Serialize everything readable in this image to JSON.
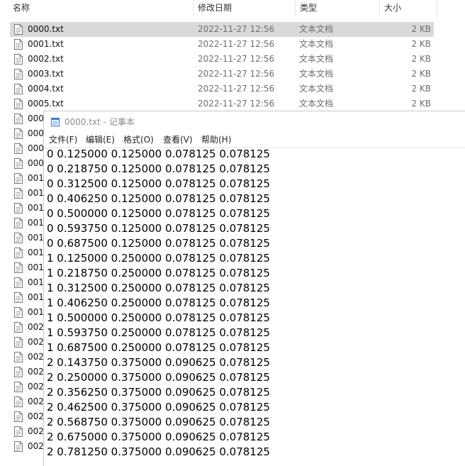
{
  "explorer": {
    "columns": {
      "name": "名称",
      "modified": "修改日期",
      "type": "类型",
      "size": "大小"
    },
    "files": [
      {
        "name": "0000.txt",
        "modified": "2022-11-27 12:56",
        "type": "文本文档",
        "size": "2 KB",
        "selected": true
      },
      {
        "name": "0001.txt",
        "modified": "2022-11-27 12:56",
        "type": "文本文档",
        "size": "2 KB"
      },
      {
        "name": "0002.txt",
        "modified": "2022-11-27 12:56",
        "type": "文本文档",
        "size": "2 KB"
      },
      {
        "name": "0003.txt",
        "modified": "2022-11-27 12:56",
        "type": "文本文档",
        "size": "2 KB"
      },
      {
        "name": "0004.txt",
        "modified": "2022-11-27 12:56",
        "type": "文本文档",
        "size": "2 KB"
      },
      {
        "name": "0005.txt",
        "modified": "2022-11-27 12:56",
        "type": "文本文档",
        "size": "2 KB"
      }
    ],
    "partial_files": [
      "000",
      "000",
      "000",
      "000",
      "001",
      "001",
      "001",
      "001",
      "001",
      "001",
      "001",
      "001",
      "001",
      "001",
      "002",
      "002",
      "002",
      "002",
      "002",
      "002",
      "002",
      "002",
      "002"
    ]
  },
  "notepad": {
    "title": "0000.txt - 记事本",
    "menu": [
      "文件(F)",
      "编辑(E)",
      "格式(O)",
      "查看(V)",
      "帮助(H)"
    ],
    "lines": [
      "0 0.125000 0.125000 0.078125 0.078125",
      "0 0.218750 0.125000 0.078125 0.078125",
      "0 0.312500 0.125000 0.078125 0.078125",
      "0 0.406250 0.125000 0.078125 0.078125",
      "0 0.500000 0.125000 0.078125 0.078125",
      "0 0.593750 0.125000 0.078125 0.078125",
      "0 0.687500 0.125000 0.078125 0.078125",
      "1 0.125000 0.250000 0.078125 0.078125",
      "1 0.218750 0.250000 0.078125 0.078125",
      "1 0.312500 0.250000 0.078125 0.078125",
      "1 0.406250 0.250000 0.078125 0.078125",
      "1 0.500000 0.250000 0.078125 0.078125",
      "1 0.593750 0.250000 0.078125 0.078125",
      "1 0.687500 0.250000 0.078125 0.078125",
      "2 0.143750 0.375000 0.090625 0.078125",
      "2 0.250000 0.375000 0.090625 0.078125",
      "2 0.356250 0.375000 0.090625 0.078125",
      "2 0.462500 0.375000 0.090625 0.078125",
      "2 0.568750 0.375000 0.090625 0.078125",
      "2 0.675000 0.375000 0.090625 0.078125",
      "2 0.781250 0.375000 0.090625 0.078125"
    ]
  }
}
